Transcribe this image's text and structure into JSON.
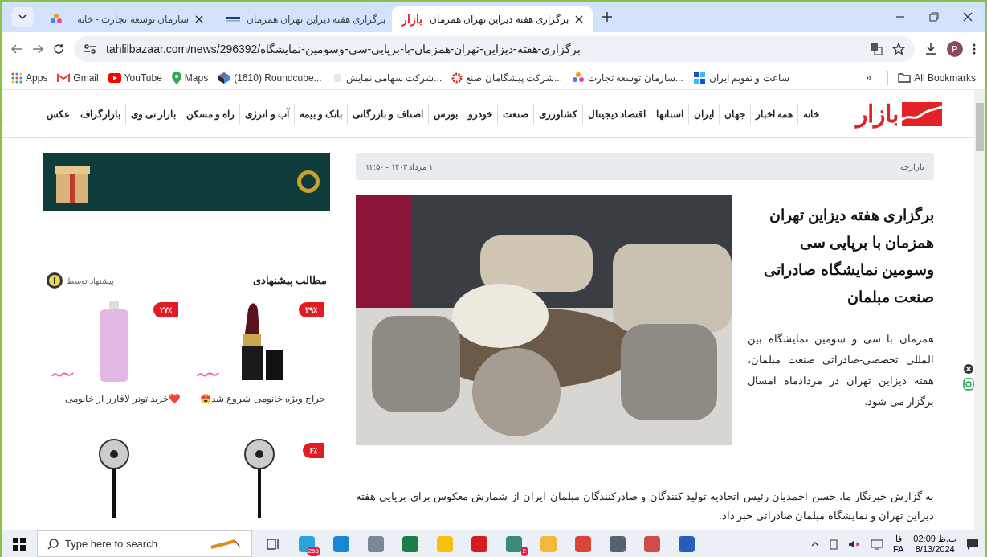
{
  "browser": {
    "tabs": [
      {
        "title": "برگزاری هفته دیزاین تهران همزمان",
        "selected": true,
        "logo": "بازار"
      },
      {
        "title": "برگزاری هفته دیزاین تهران همزمان",
        "selected": false
      },
      {
        "title": "سازمان توسعه تجارت - خانه",
        "selected": false
      }
    ],
    "url": "tahlilbazaar.com/news/296392/برگزاری-هفته-دیزاین-تهران-همزمان-با-برپایی-سی-وسومین-نمایشگاه",
    "profile_initial": "P",
    "bookmarks": [
      "ساعت و تقویم ایران",
      "سازمان توسعه تجارت...",
      "شرکت پیشگامان صنع...",
      "شرکت سهامی نمایش...",
      "(1610) Roundcube...",
      "Maps",
      "YouTube",
      "Gmail",
      "Apps"
    ],
    "overflow": "»",
    "all_bookmarks": "All Bookmarks"
  },
  "site": {
    "logo": "بازار",
    "nav": [
      "خانه",
      "همه اخبار",
      "جهان",
      "ایران",
      "استانها",
      "اقتصاد دیجیتال",
      "کشاورزی",
      "صنعت",
      "خودرو",
      "بورس",
      "اصناف و بازرگانی",
      "بانک و بیمه",
      "آب و انرژی",
      "راه و مسکن",
      "بازار تی وی",
      "بازارگراف",
      "عکس"
    ]
  },
  "article": {
    "section": "بازارچه",
    "date": "۱ مرداد ۱۴۰۳ - ۱۲:۵۰",
    "title": "برگزاری هفته دیزاین تهران همزمان با برپایی سی وسومین نمایشگاه صادراتی صنعت مبلمان",
    "lead": "همزمان با سی و سومین نمایشگاه بین المللی تخصصی-صادراتی صنعت مبلمان، هفته دیزاین تهران در مردادماه امسال برگزار می شود.",
    "body": "به گزارش خبرنگار ما، حسن احمدیان رئیس اتحادیه تولید کنندگان و صادرکنندگان مبلمان ایران از شمارش معکوس برای برپایی هفته دیزاین تهران و نمایشگاه مبلمان صادراتی خبر داد."
  },
  "recommended": {
    "title": "مطالب پیشنهادی",
    "provider": "پیشنهاد توسط",
    "items": [
      {
        "discount": "۲۹٪",
        "caption": "حراج ویژه خانومی شروع شد😍",
        "kind": "lipstick"
      },
      {
        "discount": "۲۷٪",
        "caption": "❤️خرید تونر لافارر از خانومی",
        "kind": "bottle"
      },
      {
        "discount": "۶٪",
        "kind": "fan"
      },
      {
        "kind": "fan"
      }
    ]
  },
  "taskbar": {
    "search_placeholder": "Type here to search",
    "telegram_badge": "255",
    "chat_badge": "2",
    "language": "فا",
    "language_code": "FA",
    "time": "02:09 ب.ظ",
    "date": "8/13/2024"
  }
}
